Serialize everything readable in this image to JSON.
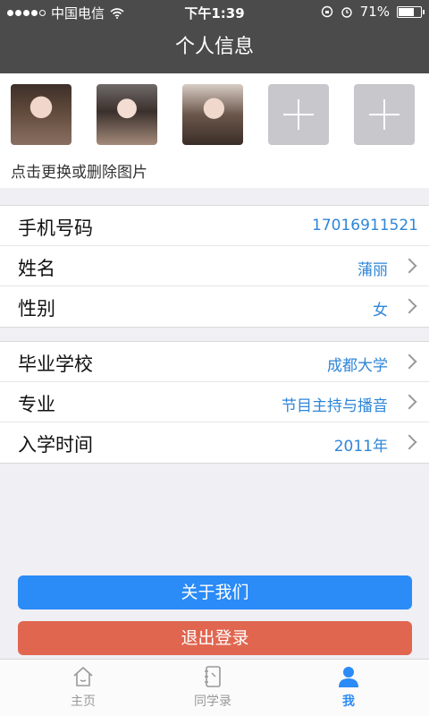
{
  "status": {
    "carrier": "中国电信",
    "time": "下午1:39",
    "battery_text": "71%",
    "battery_level": 0.71
  },
  "header": {
    "title": "个人信息"
  },
  "photos": {
    "hint": "点击更换或删除图片"
  },
  "group1": [
    {
      "label": "手机号码",
      "value": "17016911521"
    },
    {
      "label": "姓名",
      "value": "蒲丽"
    },
    {
      "label": "性别",
      "value": "女"
    }
  ],
  "group2": [
    {
      "label": "毕业学校",
      "value": "成都大学"
    },
    {
      "label": "专业",
      "value": "节目主持与播音"
    },
    {
      "label": "入学时间",
      "value": "2011年"
    }
  ],
  "buttons": {
    "about": "关于我们",
    "logout": "退出登录"
  },
  "tabs": [
    {
      "label": "主页",
      "icon": "home-icon"
    },
    {
      "label": "同学录",
      "icon": "notebook-icon"
    },
    {
      "label": "我",
      "icon": "person-icon",
      "active": true
    }
  ],
  "colors": {
    "accent": "#2b8bf7",
    "logout": "#e06650",
    "header": "#4b4b4b",
    "value_text": "#2f86d8"
  }
}
